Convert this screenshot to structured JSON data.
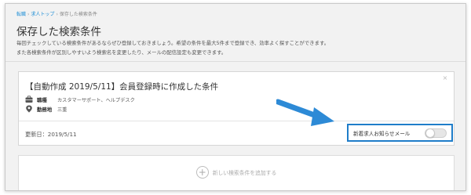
{
  "breadcrumb": {
    "items": [
      "転職",
      "求人トップ",
      "保存した検索条件"
    ]
  },
  "page": {
    "title": "保存した検索条件",
    "description_line1": "毎回チェックしている検索条件があるならぜひ登録しておきましょう。希望の条件を最大5件まで登録でき、効率よく探すことができます。",
    "description_line2": "また各検索条件が区別しやすいよう検索名を変更したり、メールの配信設定も変更できます。"
  },
  "saved_search": {
    "title": "【自動作成 2019/5/11】会員登録時に作成した条件",
    "job_type_label": "職種",
    "job_type_value": "カスタマーサポート、ヘルプデスク",
    "location_label": "勤務地",
    "location_value": "三重",
    "updated": "更新日：2019/5/11",
    "notify_label": "新着求人お知らせメール",
    "notify_enabled": false,
    "close_glyph": "×"
  },
  "add_search": {
    "plus_glyph": "+",
    "label": "新しい検索条件を追加する"
  },
  "colors": {
    "link": "#1e8ed6",
    "highlight": "#1f7dc9",
    "arrow": "#2d8ad6"
  },
  "icons": [
    "briefcase-icon",
    "location-pin-icon",
    "close-icon",
    "plus-icon",
    "arrow-icon"
  ]
}
